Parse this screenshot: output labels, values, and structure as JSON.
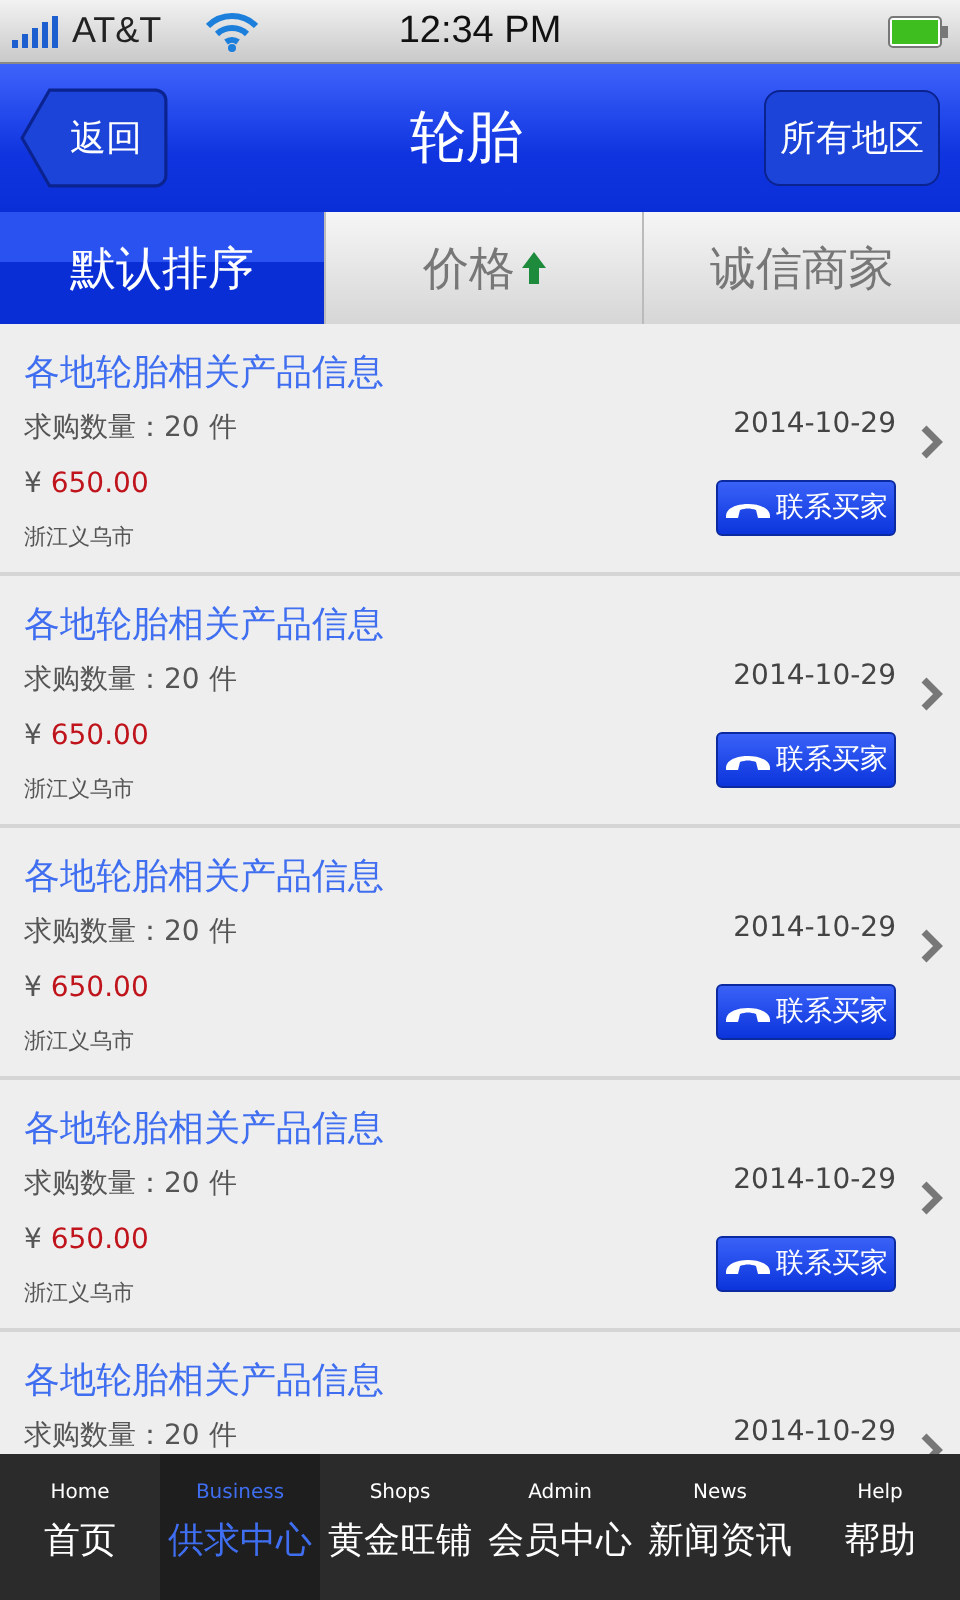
{
  "status_bar": {
    "carrier": "AT&T",
    "time": "12:34 PM"
  },
  "nav": {
    "back": "返回",
    "title": "轮胎",
    "action": "所有地区"
  },
  "sort_tabs": [
    {
      "label": "默认排序",
      "selected": true
    },
    {
      "label": "价格",
      "selected": false,
      "sort_ascending": true
    },
    {
      "label": "诚信商家",
      "selected": false
    }
  ],
  "items": [
    {
      "title": "各地轮胎相关产品信息",
      "quantity": "求购数量：20 件",
      "date": "2014-10-29",
      "currency": "¥",
      "price": "650.00",
      "location": "浙江义乌市",
      "button": "联系买家"
    },
    {
      "title": "各地轮胎相关产品信息",
      "quantity": "求购数量：20 件",
      "date": "2014-10-29",
      "currency": "¥",
      "price": "650.00",
      "location": "浙江义乌市",
      "button": "联系买家"
    },
    {
      "title": "各地轮胎相关产品信息",
      "quantity": "求购数量：20 件",
      "date": "2014-10-29",
      "currency": "¥",
      "price": "650.00",
      "location": "浙江义乌市",
      "button": "联系买家"
    },
    {
      "title": "各地轮胎相关产品信息",
      "quantity": "求购数量：20 件",
      "date": "2014-10-29",
      "currency": "¥",
      "price": "650.00",
      "location": "浙江义乌市",
      "button": "联系买家"
    },
    {
      "title": "各地轮胎相关产品信息",
      "quantity": "求购数量：20 件",
      "date": "2014-10-29"
    }
  ],
  "tab_bar": [
    {
      "en": "Home",
      "label": "首页",
      "selected": false
    },
    {
      "en": "Business",
      "label": "供求中心",
      "selected": true
    },
    {
      "en": "Shops",
      "label": "黄金旺铺",
      "selected": false
    },
    {
      "en": "Admin",
      "label": "会员中心",
      "selected": false
    },
    {
      "en": "News",
      "label": "新闻资讯",
      "selected": false
    },
    {
      "en": "Help",
      "label": "帮助",
      "selected": false
    }
  ]
}
